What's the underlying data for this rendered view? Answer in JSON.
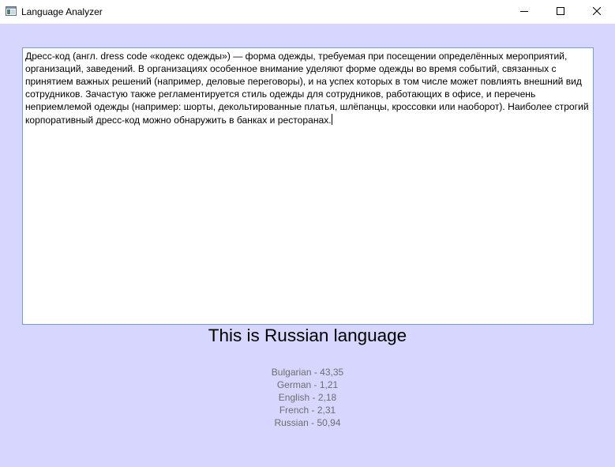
{
  "window": {
    "title": "Language Analyzer",
    "app_icon": "window-app-icon",
    "background_color": "#d6d6ff"
  },
  "caption_buttons": {
    "minimize_icon": "minimize-icon",
    "maximize_icon": "maximize-icon",
    "close_icon": "close-icon"
  },
  "input": {
    "text": "Дресс-код (англ. dress code «кодекс одежды») — форма одежды, требуемая при посещении определённых мероприятий, организаций, заведений. В организациях особенное внимание уделяют форме одежды во время событий, связанных с принятием важных решений (например, деловые переговоры), и на успех которых в том числе может повлиять внешний вид сотрудников. Зачастую также регламентируется стиль одежды для сотрудников, работающих в офисе, и перечень неприемлемой одежды (например: шорты, декольтированные платья, шлёпанцы, кроссовки или наоборот). Наиболее строгий корпоративный дресс-код можно обнаружить в банках и ресторанах.",
    "border_color": "#7a9cd3"
  },
  "result": {
    "text": "This is Russian language"
  },
  "scores": [
    {
      "label": "Bulgarian - 43,35"
    },
    {
      "label": "German - 1,21"
    },
    {
      "label": "English - 2,18"
    },
    {
      "label": "French - 2,31"
    },
    {
      "label": "Russian - 50,94"
    }
  ]
}
